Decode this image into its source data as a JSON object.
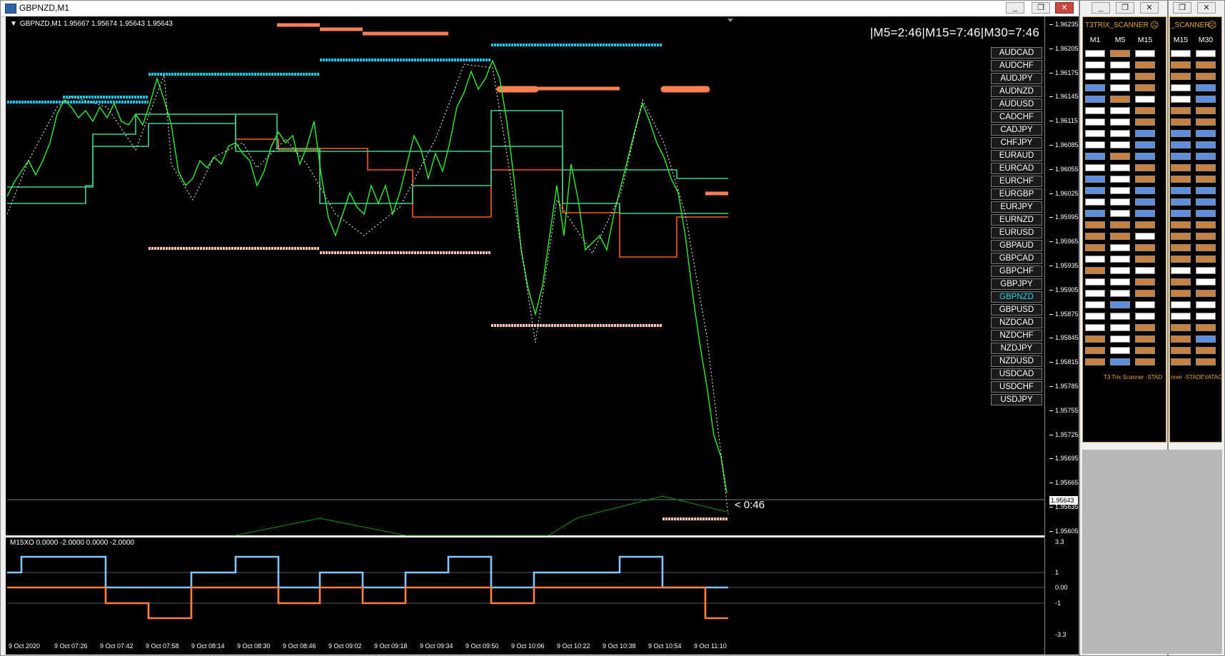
{
  "window": {
    "title": "GBPNZD,M1",
    "buttons": [
      "_",
      "❐",
      "✕"
    ]
  },
  "chart": {
    "header": "GBPNZD,M1  1.95667 1.95674 1.95643 1.95643",
    "ticker": "|M5=2:46|M15=7:46|M30=7:46",
    "countdown": "< 0:46",
    "current_price": "1.95643",
    "price_labels": [
      "1.96235",
      "1.96205",
      "1.96175",
      "1.96145",
      "1.96115",
      "1.96085",
      "1.96055",
      "1.96025",
      "1.95995",
      "1.95965",
      "1.95935",
      "1.95905",
      "1.95875",
      "1.95845",
      "1.95815",
      "1.95785",
      "1.95755",
      "1.95725",
      "1.95695",
      "1.95665",
      "1.95635",
      "1.95605"
    ],
    "time_labels": [
      "9 Oct 2020",
      "9 Oct 07:26",
      "9 Oct 07:42",
      "9 Oct 07:58",
      "9 Oct 08:14",
      "9 Oct 08:30",
      "9 Oct 08:46",
      "9 Oct 09:02",
      "9 Oct 09:18",
      "9 Oct 09:34",
      "9 Oct 09:50",
      "9 Oct 10:06",
      "9 Oct 10:22",
      "9 Oct 10:38",
      "9 Oct 10:54",
      "9 Oct 11:10"
    ],
    "pairs": [
      "AUDCAD",
      "AUDCHF",
      "AUDJPY",
      "AUDNZD",
      "AUDUSD",
      "CADCHF",
      "CADJPY",
      "CHFJPY",
      "EURAUD",
      "EURCAD",
      "EURCHF",
      "EURGBP",
      "EURJPY",
      "EURNZD",
      "EURUSD",
      "GBPAUD",
      "GBPCAD",
      "GBPCHF",
      "GBPJPY",
      "GBPNZD",
      "GBPUSD",
      "NZDCAD",
      "NZDCHF",
      "NZDJPY",
      "NZDUSD",
      "USDCAD",
      "USDCHF",
      "USDJPY"
    ],
    "active_pair": "GBPNZD",
    "indicator": {
      "title": "M15XO 0.0000 -2.0000 0.0000 -2.0000",
      "labels": [
        "3.3",
        "1",
        "0.00",
        "-1",
        "-3.3"
      ]
    }
  },
  "scanner1": {
    "title": "T3TRIX_SCANNER",
    "columns": [
      "M1",
      "M5",
      "M15"
    ],
    "footer": "T3 Trix Scanner -STAD",
    "rows": [
      [
        "w",
        "o",
        "w"
      ],
      [
        "w",
        "w",
        "o"
      ],
      [
        "w",
        "w",
        "o"
      ],
      [
        "b",
        "w",
        "o"
      ],
      [
        "b",
        "o",
        "w"
      ],
      [
        "w",
        "w",
        "o"
      ],
      [
        "w",
        "w",
        "o"
      ],
      [
        "w",
        "w",
        "b"
      ],
      [
        "w",
        "w",
        "b"
      ],
      [
        "b",
        "o",
        "b"
      ],
      [
        "w",
        "w",
        "o"
      ],
      [
        "b",
        "w",
        "o"
      ],
      [
        "b",
        "w",
        "b"
      ],
      [
        "w",
        "w",
        "b"
      ],
      [
        "b",
        "w",
        "b"
      ],
      [
        "o",
        "o",
        "o"
      ],
      [
        "o",
        "o",
        "w"
      ],
      [
        "o",
        "w",
        "o"
      ],
      [
        "w",
        "w",
        "o"
      ],
      [
        "o",
        "w",
        "w"
      ],
      [
        "w",
        "w",
        "o"
      ],
      [
        "w",
        "w",
        "o"
      ],
      [
        "w",
        "b",
        "w"
      ],
      [
        "w",
        "w",
        "w"
      ],
      [
        "w",
        "w",
        "o"
      ],
      [
        "o",
        "w",
        "o"
      ],
      [
        "o",
        "w",
        "o"
      ],
      [
        "o",
        "b",
        "o"
      ]
    ]
  },
  "scanner2": {
    "title": "_SCANNER",
    "columns": [
      "M15",
      "M30"
    ],
    "footer": "nner -STADEVATAO",
    "rows": [
      [
        "w",
        "w"
      ],
      [
        "o",
        "o"
      ],
      [
        "o",
        "o"
      ],
      [
        "w",
        "b"
      ],
      [
        "w",
        "b"
      ],
      [
        "o",
        "o"
      ],
      [
        "o",
        "o"
      ],
      [
        "b",
        "b"
      ],
      [
        "b",
        "b"
      ],
      [
        "b",
        "b"
      ],
      [
        "o",
        "o"
      ],
      [
        "o",
        "o"
      ],
      [
        "b",
        "b"
      ],
      [
        "b",
        "b"
      ],
      [
        "b",
        "b"
      ],
      [
        "o",
        "o"
      ],
      [
        "o",
        "o"
      ],
      [
        "o",
        "o"
      ],
      [
        "o",
        "o"
      ],
      [
        "w",
        "w"
      ],
      [
        "o",
        "w"
      ],
      [
        "o",
        "o"
      ],
      [
        "w",
        "w"
      ],
      [
        "w",
        "w"
      ],
      [
        "o",
        "o"
      ],
      [
        "o",
        "b"
      ],
      [
        "o",
        "o"
      ],
      [
        "o",
        "o"
      ]
    ]
  }
}
